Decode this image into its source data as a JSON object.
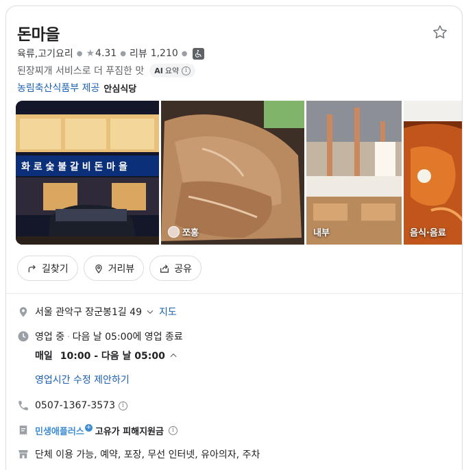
{
  "place": {
    "name": "돈마을",
    "category": "육류,고기요리",
    "rating": "4.31",
    "review_label": "리뷰",
    "review_count": "1,210"
  },
  "summary": {
    "text": "된장찌개 서비스로 더 푸짐한 맛",
    "ai_badge_prefix": "AI",
    "ai_badge_label": "요약"
  },
  "source": {
    "link_text": "농림축산식품부 제공",
    "brand": "안심식당"
  },
  "photos": [
    {
      "label": "",
      "icon": "storefront-photo"
    },
    {
      "label": "쪼홍",
      "icon": "user-avatar"
    },
    {
      "label": "내부",
      "icon": "interior-photo"
    },
    {
      "label": "음식·음료",
      "icon": "food-photo"
    }
  ],
  "actions": {
    "directions": "길찾기",
    "street_view": "거리뷰",
    "share": "공유"
  },
  "info": {
    "address": "서울 관악구 장군봉1길 49",
    "map_link": "지도",
    "status": "영업 중",
    "next_close": "다음 날 05:00에 영업 종료",
    "hours_day": "매일",
    "hours_range": "10:00 - 다음 날 05:00",
    "suggest_edit": "영업시간 수정 제안하기",
    "phone": "0507-1367-3573",
    "brand_name": "민생애플러스",
    "brand_plus": "+",
    "brand_suffix": "고유가 피해지원금",
    "amenities": "단체 이용 가능, 예약, 포장, 무선 인터넷, 유아의자, 주차"
  },
  "colors": {
    "link": "#1a5fb4",
    "brand": "#3d8bd3",
    "border": "#dadce0"
  }
}
